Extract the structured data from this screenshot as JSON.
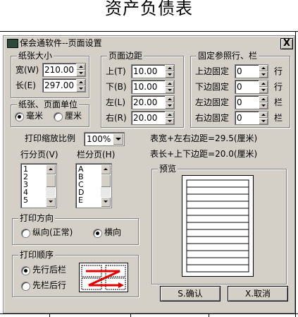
{
  "page": {
    "title": "资产负债表"
  },
  "dialog": {
    "title": "保会通软件--页面设置",
    "close_label": "X",
    "paper_size": {
      "title": "纸张大小",
      "width_label": "宽(W)",
      "width_value": "210.00",
      "height_label": "长(E)",
      "height_value": "297.00"
    },
    "unit": {
      "title": "纸张、页面单位",
      "options": [
        "毫米",
        "厘米"
      ],
      "selected": "毫米"
    },
    "margins": {
      "title": "页面边距",
      "top_label": "上(T)",
      "top_value": "10.00",
      "bottom_label": "下(B)",
      "bottom_value": "10.00",
      "left_label": "左(L)",
      "left_value": "20.00",
      "right_label": "右(R)",
      "right_value": "20.00"
    },
    "fixed": {
      "title": "固定参照行、栏",
      "top_label": "上边固定",
      "top_value": "0",
      "top_unit": "行",
      "bottom_label": "下边固定",
      "bottom_value": "0",
      "bottom_unit": "行",
      "left_label": "左边固定",
      "left_value": "0",
      "left_unit": "栏",
      "right_label": "右边固定",
      "right_value": "0",
      "right_unit": "栏"
    },
    "scale": {
      "label": "打印缩放比例",
      "value": "100%"
    },
    "info": {
      "width_line": "表宽+左右边距=29.5(厘米)",
      "height_line": "表长+上下边距=20.0(厘米)"
    },
    "row_pages": {
      "label": "行分页(V)",
      "items": [
        "1",
        "2",
        "3",
        "4",
        "5"
      ]
    },
    "col_pages": {
      "label": "栏分页(H)",
      "items": [
        "A",
        "B",
        "C",
        "D",
        "E"
      ]
    },
    "preview": {
      "title": "预览"
    },
    "orientation": {
      "title": "打印方向",
      "options": [
        "纵向(正常)",
        "横向"
      ],
      "selected": "横向"
    },
    "order": {
      "title": "打印顺序",
      "options": [
        "先行后栏",
        "先栏后行"
      ],
      "selected": "先行后栏"
    },
    "ok_label": "S.确认",
    "cancel_label": "X.取消"
  }
}
